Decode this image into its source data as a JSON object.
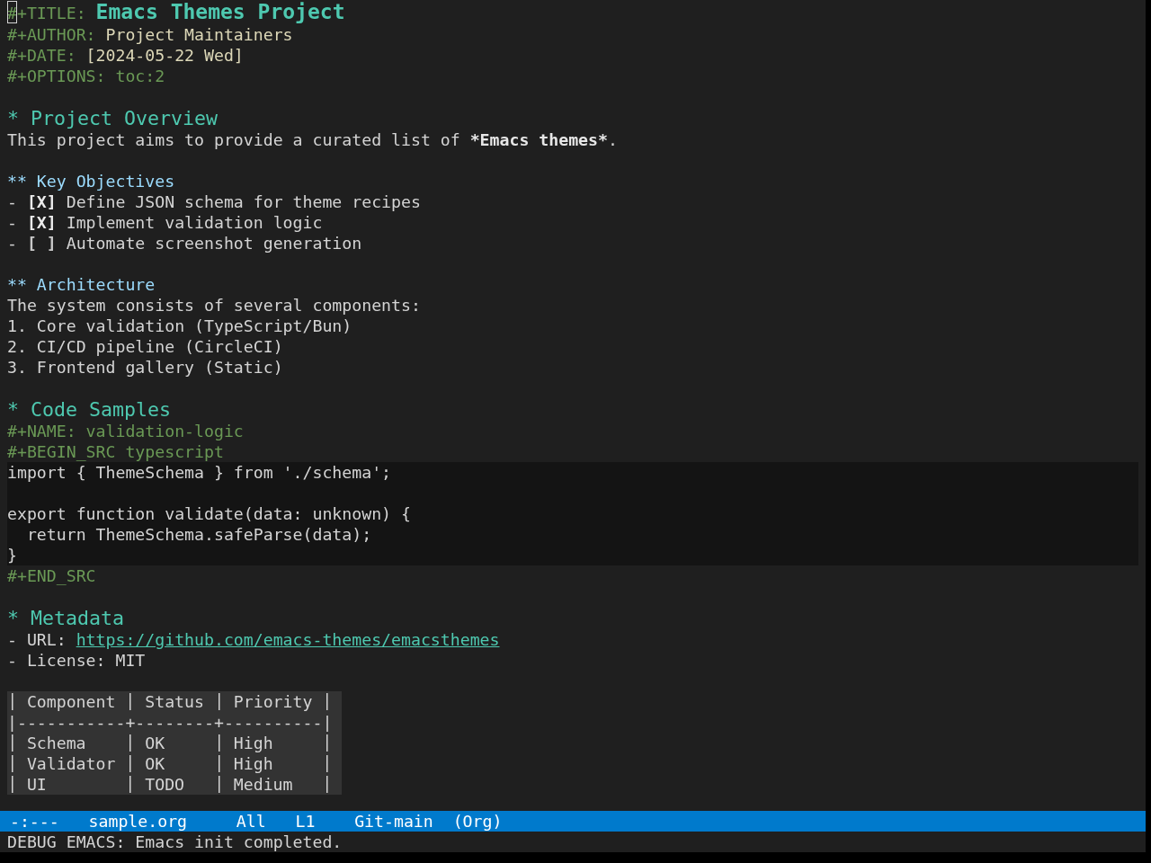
{
  "buffer": {
    "cursor_visible": true,
    "header": [
      {
        "kind": "title",
        "keyword": "#+TITLE:",
        "value": "Emacs Themes Project"
      },
      {
        "kind": "author",
        "keyword": "#+AUTHOR:",
        "value": "Project Maintainers"
      },
      {
        "kind": "date",
        "keyword": "#+DATE:",
        "value": "[2024-05-22 Wed]"
      },
      {
        "kind": "option",
        "keyword": "#+OPTIONS:",
        "value": "toc:2"
      }
    ],
    "sections": [
      {
        "marker": "*",
        "title": "Project Overview",
        "content": [
          {
            "kind": "paragraph",
            "text": "This project aims to provide a curated list of ",
            "emphasis": "*Emacs themes*",
            "text_after": "."
          }
        ],
        "subsections": [
          {
            "marker": "**",
            "title": "Key Objectives",
            "content": [
              {
                "kind": "checklist",
                "items": [
                  {
                    "bullet": "-",
                    "box": "[X]",
                    "checked": true,
                    "text": "Define JSON schema for theme recipes"
                  },
                  {
                    "bullet": "-",
                    "box": "[X]",
                    "checked": true,
                    "text": "Implement validation logic"
                  },
                  {
                    "bullet": "-",
                    "box": "[ ]",
                    "checked": false,
                    "text": "Automate screenshot generation"
                  }
                ]
              }
            ]
          },
          {
            "marker": "**",
            "title": "Architecture",
            "content": [
              {
                "kind": "numbered_list",
                "lead": "The system consists of several components:",
                "items": [
                  {
                    "number": "1.",
                    "text": "Core validation (TypeScript/Bun)"
                  },
                  {
                    "number": "2.",
                    "text": "CI/CD pipeline (CircleCI)"
                  },
                  {
                    "number": "3.",
                    "text": "Frontend gallery (Static)"
                  }
                ]
              }
            ]
          }
        ]
      },
      {
        "marker": "*",
        "title": "Code Samples",
        "content": [
          {
            "kind": "src_block",
            "name_line": "#+NAME: validation-logic",
            "begin": "#+BEGIN_SRC typescript",
            "code": "import { ThemeSchema } from './schema';\n\nexport function validate(data: unknown) {\n  return ThemeSchema.safeParse(data);\n}",
            "end": "#+END_SRC"
          }
        ]
      },
      {
        "marker": "*",
        "title": "Metadata",
        "content": [
          {
            "kind": "field_list",
            "items": [
              {
                "kind": "link",
                "bullet": "-",
                "label": "URL:",
                "value": "https://github.com/emacs-themes/emacsthemes"
              },
              {
                "kind": "text",
                "bullet": "-",
                "label": "License:",
                "value": "MIT"
              }
            ]
          },
          {
            "kind": "table",
            "columns": [
              "Component",
              "Status",
              "Priority"
            ],
            "separator": "|-----------+--------+----------|",
            "rows": [
              [
                "Schema",
                "OK",
                "High"
              ],
              [
                "Validator",
                "OK",
                "High"
              ],
              [
                "UI",
                "TODO",
                "Medium"
              ]
            ]
          }
        ]
      }
    ]
  },
  "mode_line": [
    "-:---",
    "sample.org",
    "All",
    "L1",
    "Git-main",
    "(Org)"
  ],
  "echo_area": {
    "message": "DEBUG EMACS: Emacs init completed."
  }
}
